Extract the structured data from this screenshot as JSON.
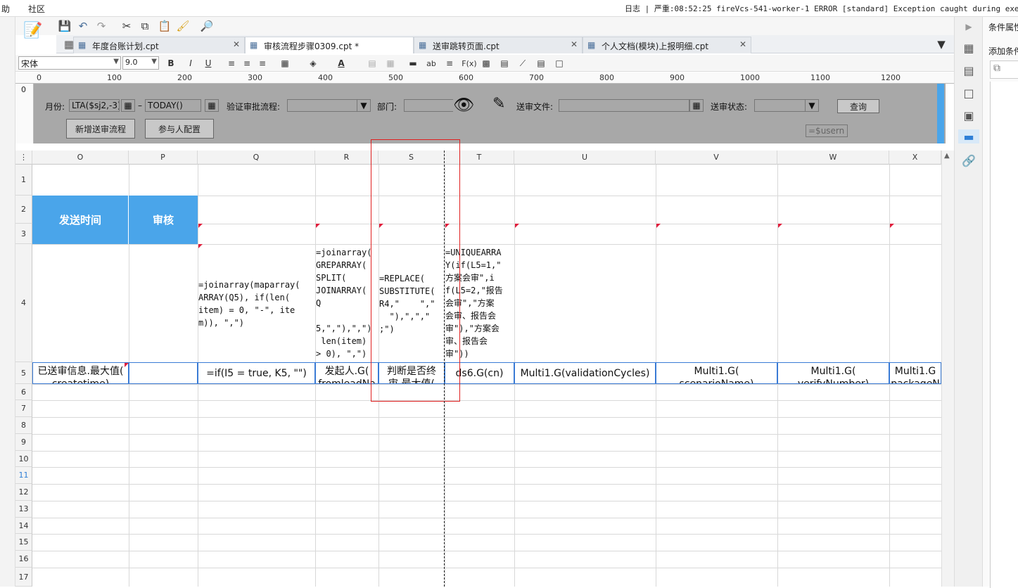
{
  "menu": {
    "help": "助",
    "community": "社区"
  },
  "log": {
    "text": "日志 | 严重:08:52:25 fireVcs-541-worker-1 ERROR [standard] Exception caught during execution"
  },
  "font": {
    "family": "宋体",
    "size": "9.0"
  },
  "tabs": [
    {
      "label": "年度台账计划.cpt",
      "active": false
    },
    {
      "label": "审核流程步骤0309.cpt *",
      "active": true
    },
    {
      "label": "送审跳转页面.cpt",
      "active": false
    },
    {
      "label": "个人文档(模块)上报明细.cpt",
      "active": false
    }
  ],
  "format_icons": {
    "bold": "B",
    "italic": "I",
    "underline": "U",
    "text": "ab",
    "formula": "F(x)"
  },
  "ruler": {
    "marks": [
      "0",
      "100",
      "200",
      "300",
      "400",
      "500",
      "600",
      "700",
      "800",
      "900",
      "1000",
      "1100",
      "1200"
    ],
    "v0": "0"
  },
  "params": {
    "month_label": "月份:",
    "month_value": "LTA($sj2,-3)",
    "dash": "–",
    "end_value": "TODAY()",
    "verify_label": "验证审批流程:",
    "dept_label": "部门:",
    "file_label": "送审文件:",
    "status_label": "送审状态:",
    "query_button": "查询",
    "new_flow_button": "新增送审流程",
    "participant_button": "参与人配置",
    "user_field": "=$usern"
  },
  "columns": [
    "O",
    "P",
    "Q",
    "R",
    "S",
    "T",
    "U",
    "V",
    "W",
    "X"
  ],
  "rows": [
    "1",
    "2",
    "3",
    "4",
    "5",
    "6",
    "7",
    "8",
    "9",
    "10",
    "11",
    "12",
    "13",
    "14",
    "15",
    "16",
    "17"
  ],
  "cells": {
    "O2": "发送时间",
    "P2": "审核",
    "Q4": "=joinarray(maparray(\nARRAY(Q5), if(len(\nitem) = 0, \"-\", ite\nm)), \",\")",
    "R4": "=joinarray(\nGREPARRAY(\nSPLIT(\nJOINARRAY(\nQ\n\n5,\",\"),\",\")\n len(item)\n> 0), \",\")",
    "S4": "=REPLACE(\nSUBSTITUTE(\nR4,\"    \",\"\n  \"),\",\",\"\n;\")",
    "T4": "=UNIQUEARRA\nY(if(L5=1,\"\n方案会审\",i\nf(L5=2,\"报告\n会审\",\"方案\n会审、报告会\n审\"),\"方案会\n审、报告会\n审\"))",
    "O5": "已送审信息.最大值(\ncreatetime)",
    "Q5": "=if(I5 = true, K5, \"\")",
    "R5": "发起人.G(\nfromleadNa",
    "S5": "判断是否终\n审.最大值(",
    "T5": "ds6.G(cn)",
    "U5": "Multi1.G(validationCycles)",
    "V5": "Multi1.G(\nscenarioName)",
    "W5": "Multi1.G(\nverifyNumber)",
    "X5": "Multi1.G\npackageN"
  },
  "right_panel": {
    "title": "条件属性",
    "add": "添加条件"
  }
}
